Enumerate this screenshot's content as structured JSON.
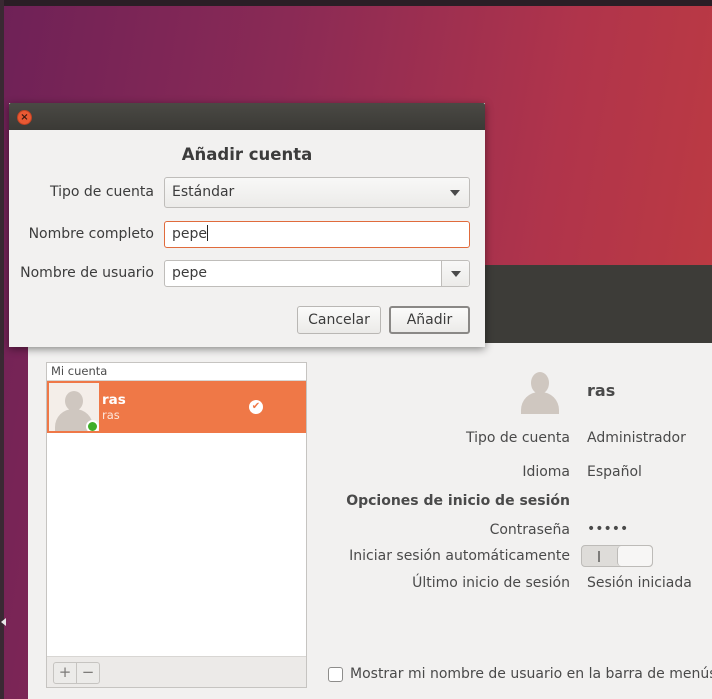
{
  "dialog": {
    "title": "Añadir cuenta",
    "close_glyph": "×",
    "account_type_label": "Tipo de cuenta",
    "account_type_value": "Estándar",
    "full_name_label": "Nombre completo",
    "full_name_value": "pepe",
    "username_label": "Nombre de usuario",
    "username_value": "pepe",
    "cancel_label": "Cancelar",
    "add_label": "Añadir"
  },
  "accounts_list": {
    "header": "Mi cuenta",
    "items": [
      {
        "name": "ras",
        "login": "ras",
        "check_glyph": "✔"
      }
    ],
    "add_glyph": "+",
    "remove_glyph": "−"
  },
  "details": {
    "username": "ras",
    "rows": [
      {
        "label": "Tipo de cuenta",
        "value": "Administrador"
      },
      {
        "label": "Idioma",
        "value": "Español"
      }
    ],
    "login_options_heading": "Opciones de inicio de sesión",
    "password_label": "Contraseña",
    "password_value": "•••••",
    "autologin_label": "Iniciar sesión automáticamente",
    "last_login_label": "Último inicio de sesión",
    "last_login_value": "Sesión iniciada",
    "show_name_label": "Mostrar mi nombre de usuario en la barra de menús"
  },
  "colors": {
    "accent": "#ef7847",
    "online": "#3fae29",
    "close": "#e95933"
  }
}
